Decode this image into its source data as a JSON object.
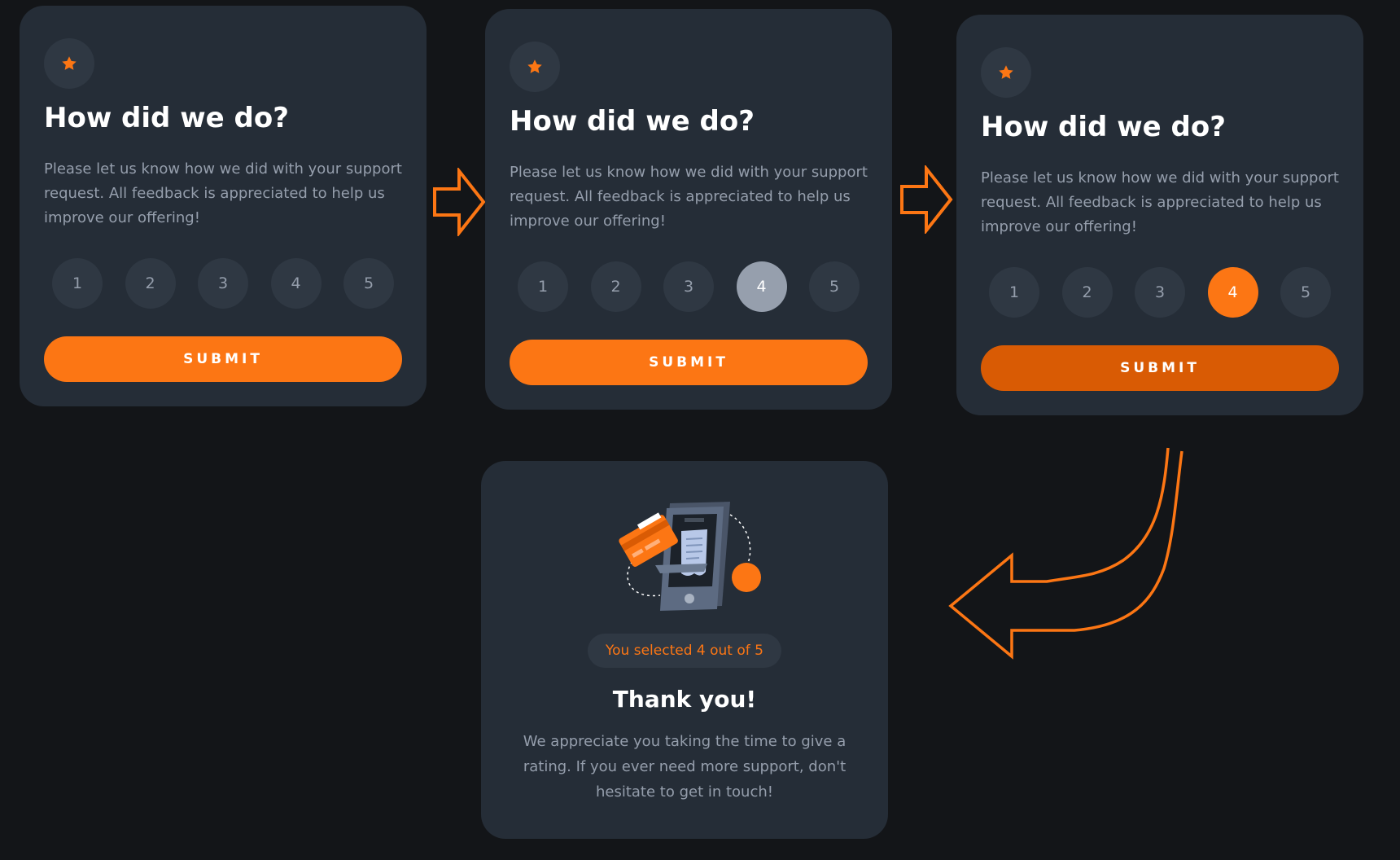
{
  "rating_card": {
    "title": "How did we do?",
    "description": "Please let us know how we did with your support request. All feedback is appreciated to help us improve our offering!",
    "ratings": [
      "1",
      "2",
      "3",
      "4",
      "5"
    ],
    "submit_label": "SUBMIT"
  },
  "thank_you_card": {
    "selected_text": "You selected 4 out of 5",
    "title": "Thank you!",
    "description": "We appreciate you taking the time to give a rating. If you ever need more support, don't hesitate to get in touch!"
  },
  "colors": {
    "accent": "#fc7614",
    "accent_hover": "#d95b04",
    "card_bg": "#252d37",
    "page_bg": "#131518",
    "muted_text": "#959eac",
    "selected_gray": "#969fad"
  },
  "icons": [
    "star-icon",
    "arrow-right-icon",
    "curved-arrow-left-icon",
    "payment-illustration"
  ]
}
